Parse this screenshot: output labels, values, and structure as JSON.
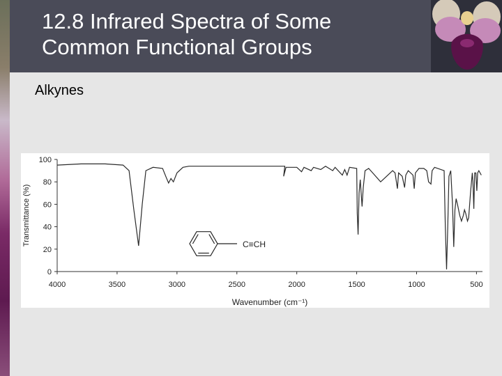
{
  "slide": {
    "title": "12.8 Infrared Spectra of Some\nCommon Functional Groups",
    "subtitle": "Alkynes"
  },
  "colors": {
    "title_bar": "#4a4b58",
    "background": "#e6e6e6",
    "title_text": "#ffffff",
    "spectrum_line": "#2a2a2a",
    "orchid_petal": "#c58ab8",
    "orchid_lip": "#5a1248"
  },
  "chart_data": {
    "type": "line",
    "title": "",
    "xlabel": "Wavenumber (cm⁻¹)",
    "ylabel": "Transmittance (%)",
    "xlim": [
      4000,
      450
    ],
    "ylim": [
      0,
      100
    ],
    "x_ticks": [
      4000,
      3500,
      3000,
      2500,
      2000,
      1500,
      1000,
      500
    ],
    "x_tick_labels": [
      "4000",
      "3500",
      "3000",
      "2500",
      "2000",
      "1500",
      "1000",
      "500"
    ],
    "y_ticks": [
      0,
      20,
      40,
      60,
      80,
      100
    ],
    "y_tick_labels": [
      "0",
      "20",
      "40",
      "60",
      "80",
      "100"
    ],
    "grid": false,
    "molecule_label": "C≡CH",
    "series": [
      {
        "points": [
          [
            4000,
            95
          ],
          [
            3800,
            96
          ],
          [
            3600,
            96
          ],
          [
            3450,
            95
          ],
          [
            3400,
            90
          ],
          [
            3360,
            55
          ],
          [
            3320,
            23
          ],
          [
            3290,
            60
          ],
          [
            3260,
            90
          ],
          [
            3200,
            93
          ],
          [
            3120,
            92
          ],
          [
            3090,
            84
          ],
          [
            3070,
            79
          ],
          [
            3050,
            83
          ],
          [
            3030,
            80
          ],
          [
            3000,
            88
          ],
          [
            2950,
            93
          ],
          [
            2900,
            94
          ],
          [
            2500,
            94
          ],
          [
            2100,
            94
          ],
          [
            2110,
            85
          ],
          [
            2090,
            93
          ],
          [
            2000,
            93
          ],
          [
            1960,
            89
          ],
          [
            1940,
            93
          ],
          [
            1880,
            90
          ],
          [
            1860,
            93
          ],
          [
            1800,
            91
          ],
          [
            1760,
            94
          ],
          [
            1700,
            90
          ],
          [
            1680,
            93
          ],
          [
            1620,
            86
          ],
          [
            1600,
            91
          ],
          [
            1580,
            86
          ],
          [
            1560,
            93
          ],
          [
            1500,
            92
          ],
          [
            1495,
            52
          ],
          [
            1488,
            33
          ],
          [
            1480,
            70
          ],
          [
            1470,
            82
          ],
          [
            1455,
            58
          ],
          [
            1445,
            75
          ],
          [
            1430,
            90
          ],
          [
            1400,
            92
          ],
          [
            1350,
            86
          ],
          [
            1300,
            80
          ],
          [
            1250,
            85
          ],
          [
            1200,
            90
          ],
          [
            1180,
            88
          ],
          [
            1160,
            74
          ],
          [
            1150,
            88
          ],
          [
            1120,
            85
          ],
          [
            1100,
            75
          ],
          [
            1090,
            86
          ],
          [
            1070,
            90
          ],
          [
            1030,
            86
          ],
          [
            1020,
            74
          ],
          [
            1010,
            88
          ],
          [
            980,
            92
          ],
          [
            940,
            92
          ],
          [
            915,
            90
          ],
          [
            900,
            80
          ],
          [
            880,
            78
          ],
          [
            870,
            90
          ],
          [
            850,
            93
          ],
          [
            770,
            90
          ],
          [
            760,
            40
          ],
          [
            750,
            2
          ],
          [
            740,
            40
          ],
          [
            730,
            85
          ],
          [
            715,
            90
          ],
          [
            700,
            60
          ],
          [
            690,
            22
          ],
          [
            680,
            55
          ],
          [
            670,
            65
          ],
          [
            655,
            58
          ],
          [
            640,
            50
          ],
          [
            625,
            45
          ],
          [
            610,
            50
          ],
          [
            600,
            55
          ],
          [
            590,
            52
          ],
          [
            575,
            45
          ],
          [
            565,
            48
          ],
          [
            550,
            70
          ],
          [
            535,
            88
          ],
          [
            530,
            80
          ],
          [
            522,
            56
          ],
          [
            515,
            88
          ],
          [
            505,
            88
          ],
          [
            497,
            72
          ],
          [
            490,
            88
          ],
          [
            480,
            90
          ],
          [
            460,
            86
          ]
        ]
      }
    ]
  }
}
